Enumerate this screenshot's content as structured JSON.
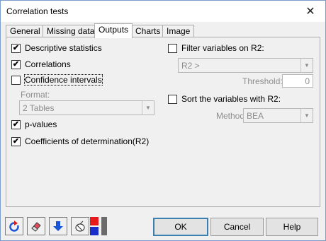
{
  "window": {
    "title": "Correlation tests"
  },
  "tabs": [
    {
      "label": "General"
    },
    {
      "label": "Missing data"
    },
    {
      "label": "Outputs"
    },
    {
      "label": "Charts"
    },
    {
      "label": "Image"
    }
  ],
  "outputs": {
    "descriptive_statistics": {
      "label": "Descriptive statistics",
      "checked": true
    },
    "correlations": {
      "label": "Correlations",
      "checked": true
    },
    "confidence_intervals": {
      "label": "Confidence intervals",
      "checked": false
    },
    "format": {
      "label": "Format:",
      "value": "2 Tables"
    },
    "p_values": {
      "label": "p-values",
      "checked": true
    },
    "coefficients": {
      "label": "Coefficients of determination(R2)",
      "checked": true
    },
    "filter": {
      "label": "Filter variables on R2:",
      "checked": false,
      "select_value": "R2 >",
      "threshold_label": "Threshold:",
      "threshold_value": "0"
    },
    "sort": {
      "label": "Sort the variables with R2:",
      "checked": false,
      "method_label": "Method:",
      "method_value": "BEA"
    }
  },
  "buttons": {
    "ok": "OK",
    "cancel": "Cancel",
    "help": "Help"
  },
  "icons": [
    "reset-icon",
    "eraser-icon",
    "download-icon",
    "pointer-select-icon",
    "color-swatch-icon"
  ],
  "colors": {
    "accent": "#3c7fb1",
    "swatch_red": "#e8191b",
    "swatch_blue": "#1a2fc7"
  }
}
